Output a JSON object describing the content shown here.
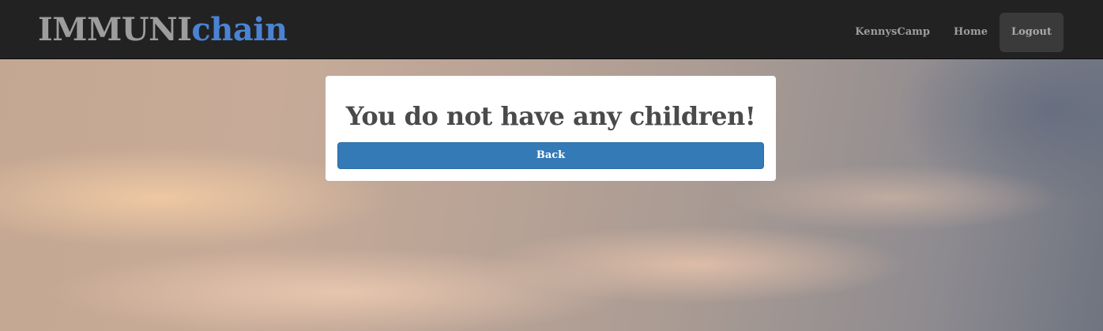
{
  "navbar": {
    "brand_part1": "IMMUNI",
    "brand_part2": "chain",
    "links": [
      {
        "label": "KennysCamp"
      },
      {
        "label": "Home"
      },
      {
        "label": "Logout"
      }
    ],
    "colors": {
      "background": "#222222",
      "link": "#9d9d9d",
      "brand_gray": "#9d9d9d",
      "brand_blue": "#4a83d4",
      "active_bg": "#3a3a3a"
    }
  },
  "main": {
    "message": "You do not have any children!",
    "back_label": "Back",
    "colors": {
      "button": "#337ab7",
      "panel": "#ffffff",
      "heading": "#4a4a4a"
    }
  }
}
